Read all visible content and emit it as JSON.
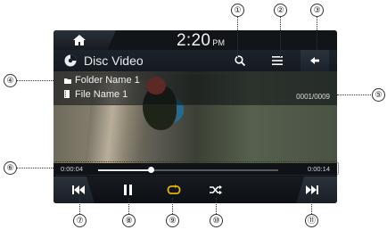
{
  "status": {
    "time": "2:20",
    "ampm": "PM"
  },
  "header": {
    "title": "Disc Video"
  },
  "info": {
    "folder": "Folder Name 1",
    "file": "File Name 1",
    "track_counter": "0001/0009"
  },
  "playback": {
    "elapsed": "0:00:04",
    "total": "0:00:14",
    "progress": 0.29
  },
  "callouts": [
    "①",
    "②",
    "③",
    "④",
    "⑤",
    "⑥",
    "⑦",
    "⑧",
    "⑨",
    "⑩",
    "⑪"
  ],
  "icons": [
    "home-icon",
    "disc-icon",
    "search-icon",
    "list-icon",
    "back-icon",
    "folder-icon",
    "file-icon",
    "previous-icon",
    "pause-icon",
    "repeat-icon",
    "shuffle-icon",
    "next-icon"
  ],
  "colors": {
    "repeat_active": "#e0b400",
    "screen_bg": "#0f1216"
  }
}
